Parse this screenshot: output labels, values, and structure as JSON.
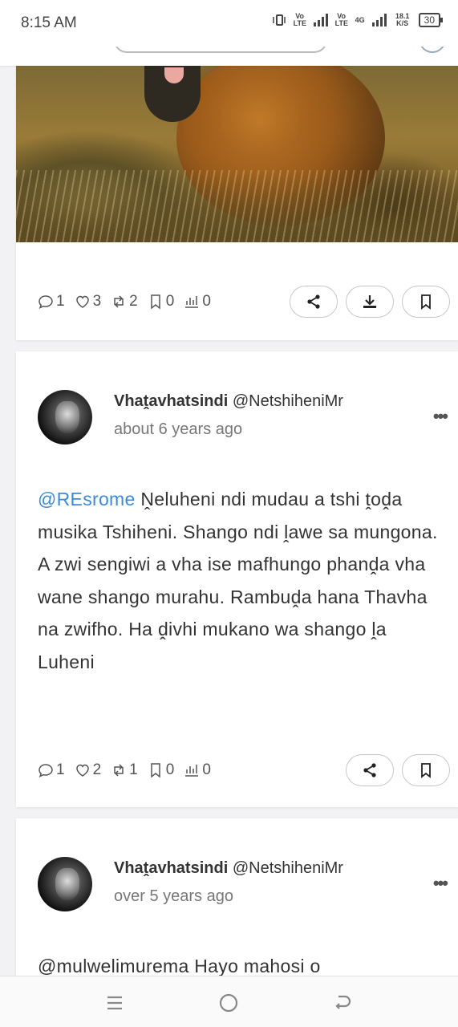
{
  "status_bar": {
    "time": "8:15 AM",
    "lte1": "Vo LTE",
    "lte2": "Vo LTE",
    "network": "4G",
    "speed": "18.1 K/S",
    "battery": "30"
  },
  "posts": [
    {
      "stats": {
        "comments": "1",
        "likes": "3",
        "reposts": "2",
        "bookmarks": "0",
        "views": "0"
      }
    },
    {
      "author_name": "Vhaṱavhatsindi",
      "author_handle": "@NetshiheniMr",
      "time": "about 6 years ago",
      "mention": "@REsrome",
      "text": "Ṋeluheni ndi mudau a tshi ṱoḓa musika Tshiheni. Shango ndi ḽawe sa mungona. A zwi sengiwi a vha ise mafhungo phanḓa vha wane shango murahu. Rambuḓa hana Thavha na zwifho. Ha ḓivhi mukano wa shango ḽa Luheni",
      "stats": {
        "comments": "1",
        "likes": "2",
        "reposts": "1",
        "bookmarks": "0",
        "views": "0"
      }
    },
    {
      "author_name": "Vhaṱavhatsindi",
      "author_handle": "@NetshiheniMr",
      "time": "over 5 years ago",
      "text": "@mulwelimurema Hayo mahosi o"
    }
  ],
  "icons": {
    "comment": "comment-icon",
    "like": "heart-icon",
    "repost": "repost-icon",
    "bookmark": "bookmark-icon",
    "views": "chart-icon",
    "share": "share-icon",
    "download": "download-icon",
    "save": "bookmark-icon",
    "nav_menu": "menu-icon",
    "nav_home": "home-circle-icon",
    "nav_back": "back-icon"
  },
  "colors": {
    "mention": "#3a8bd8",
    "background": "#f2f2f4"
  }
}
